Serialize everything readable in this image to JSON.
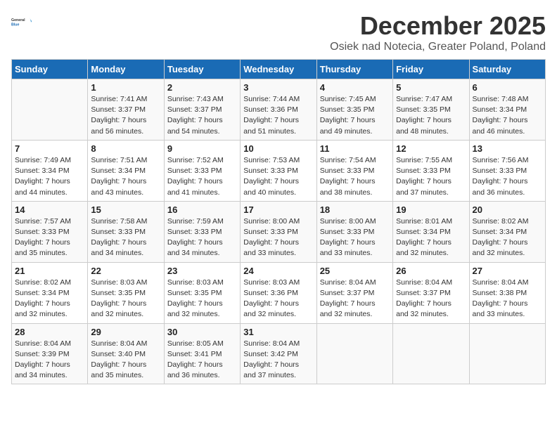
{
  "header": {
    "logo_line1": "General",
    "logo_line2": "Blue",
    "month": "December 2025",
    "location": "Osiek nad Notecia, Greater Poland, Poland"
  },
  "days_of_week": [
    "Sunday",
    "Monday",
    "Tuesday",
    "Wednesday",
    "Thursday",
    "Friday",
    "Saturday"
  ],
  "weeks": [
    [
      {
        "day": "",
        "info": ""
      },
      {
        "day": "1",
        "info": "Sunrise: 7:41 AM\nSunset: 3:37 PM\nDaylight: 7 hours\nand 56 minutes."
      },
      {
        "day": "2",
        "info": "Sunrise: 7:43 AM\nSunset: 3:37 PM\nDaylight: 7 hours\nand 54 minutes."
      },
      {
        "day": "3",
        "info": "Sunrise: 7:44 AM\nSunset: 3:36 PM\nDaylight: 7 hours\nand 51 minutes."
      },
      {
        "day": "4",
        "info": "Sunrise: 7:45 AM\nSunset: 3:35 PM\nDaylight: 7 hours\nand 49 minutes."
      },
      {
        "day": "5",
        "info": "Sunrise: 7:47 AM\nSunset: 3:35 PM\nDaylight: 7 hours\nand 48 minutes."
      },
      {
        "day": "6",
        "info": "Sunrise: 7:48 AM\nSunset: 3:34 PM\nDaylight: 7 hours\nand 46 minutes."
      }
    ],
    [
      {
        "day": "7",
        "info": "Sunrise: 7:49 AM\nSunset: 3:34 PM\nDaylight: 7 hours\nand 44 minutes."
      },
      {
        "day": "8",
        "info": "Sunrise: 7:51 AM\nSunset: 3:34 PM\nDaylight: 7 hours\nand 43 minutes."
      },
      {
        "day": "9",
        "info": "Sunrise: 7:52 AM\nSunset: 3:33 PM\nDaylight: 7 hours\nand 41 minutes."
      },
      {
        "day": "10",
        "info": "Sunrise: 7:53 AM\nSunset: 3:33 PM\nDaylight: 7 hours\nand 40 minutes."
      },
      {
        "day": "11",
        "info": "Sunrise: 7:54 AM\nSunset: 3:33 PM\nDaylight: 7 hours\nand 38 minutes."
      },
      {
        "day": "12",
        "info": "Sunrise: 7:55 AM\nSunset: 3:33 PM\nDaylight: 7 hours\nand 37 minutes."
      },
      {
        "day": "13",
        "info": "Sunrise: 7:56 AM\nSunset: 3:33 PM\nDaylight: 7 hours\nand 36 minutes."
      }
    ],
    [
      {
        "day": "14",
        "info": "Sunrise: 7:57 AM\nSunset: 3:33 PM\nDaylight: 7 hours\nand 35 minutes."
      },
      {
        "day": "15",
        "info": "Sunrise: 7:58 AM\nSunset: 3:33 PM\nDaylight: 7 hours\nand 34 minutes."
      },
      {
        "day": "16",
        "info": "Sunrise: 7:59 AM\nSunset: 3:33 PM\nDaylight: 7 hours\nand 34 minutes."
      },
      {
        "day": "17",
        "info": "Sunrise: 8:00 AM\nSunset: 3:33 PM\nDaylight: 7 hours\nand 33 minutes."
      },
      {
        "day": "18",
        "info": "Sunrise: 8:00 AM\nSunset: 3:33 PM\nDaylight: 7 hours\nand 33 minutes."
      },
      {
        "day": "19",
        "info": "Sunrise: 8:01 AM\nSunset: 3:34 PM\nDaylight: 7 hours\nand 32 minutes."
      },
      {
        "day": "20",
        "info": "Sunrise: 8:02 AM\nSunset: 3:34 PM\nDaylight: 7 hours\nand 32 minutes."
      }
    ],
    [
      {
        "day": "21",
        "info": "Sunrise: 8:02 AM\nSunset: 3:34 PM\nDaylight: 7 hours\nand 32 minutes."
      },
      {
        "day": "22",
        "info": "Sunrise: 8:03 AM\nSunset: 3:35 PM\nDaylight: 7 hours\nand 32 minutes."
      },
      {
        "day": "23",
        "info": "Sunrise: 8:03 AM\nSunset: 3:35 PM\nDaylight: 7 hours\nand 32 minutes."
      },
      {
        "day": "24",
        "info": "Sunrise: 8:03 AM\nSunset: 3:36 PM\nDaylight: 7 hours\nand 32 minutes."
      },
      {
        "day": "25",
        "info": "Sunrise: 8:04 AM\nSunset: 3:37 PM\nDaylight: 7 hours\nand 32 minutes."
      },
      {
        "day": "26",
        "info": "Sunrise: 8:04 AM\nSunset: 3:37 PM\nDaylight: 7 hours\nand 32 minutes."
      },
      {
        "day": "27",
        "info": "Sunrise: 8:04 AM\nSunset: 3:38 PM\nDaylight: 7 hours\nand 33 minutes."
      }
    ],
    [
      {
        "day": "28",
        "info": "Sunrise: 8:04 AM\nSunset: 3:39 PM\nDaylight: 7 hours\nand 34 minutes."
      },
      {
        "day": "29",
        "info": "Sunrise: 8:04 AM\nSunset: 3:40 PM\nDaylight: 7 hours\nand 35 minutes."
      },
      {
        "day": "30",
        "info": "Sunrise: 8:05 AM\nSunset: 3:41 PM\nDaylight: 7 hours\nand 36 minutes."
      },
      {
        "day": "31",
        "info": "Sunrise: 8:04 AM\nSunset: 3:42 PM\nDaylight: 7 hours\nand 37 minutes."
      },
      {
        "day": "",
        "info": ""
      },
      {
        "day": "",
        "info": ""
      },
      {
        "day": "",
        "info": ""
      }
    ]
  ]
}
